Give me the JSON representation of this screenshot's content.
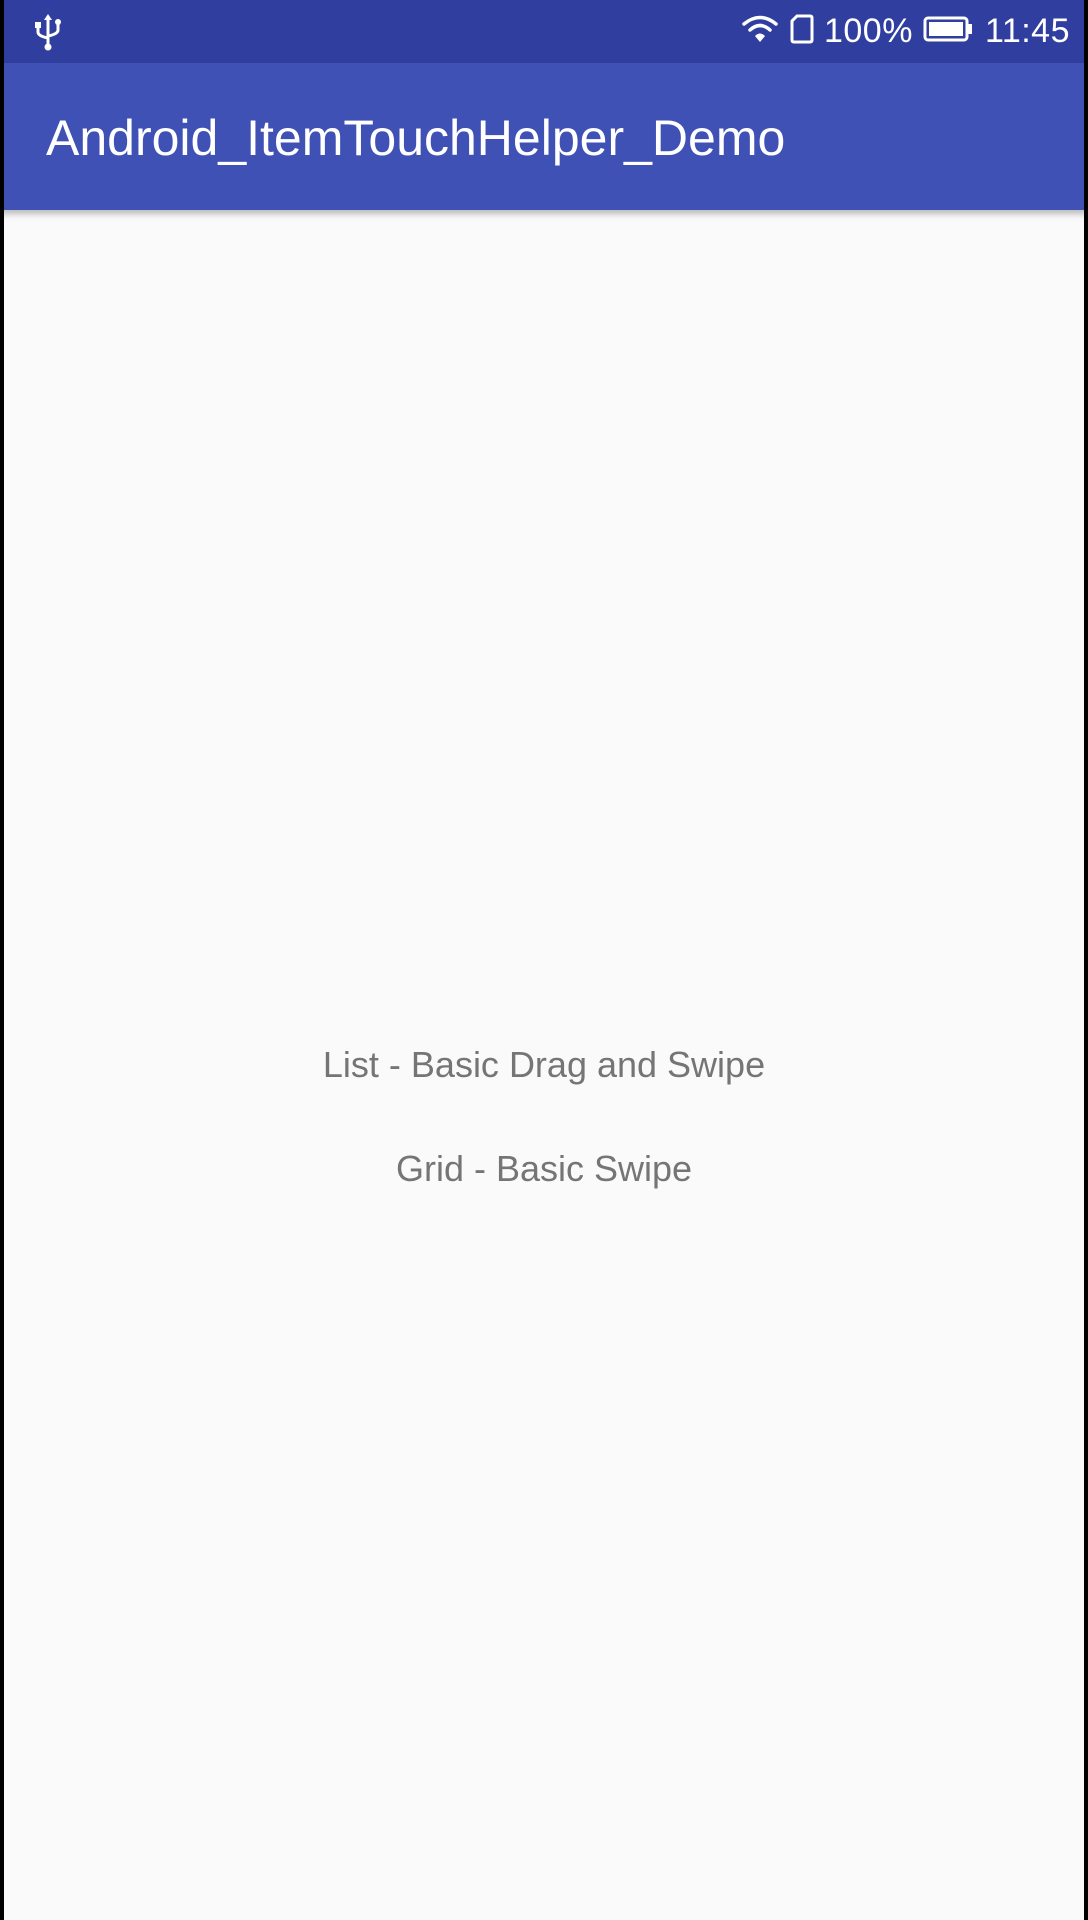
{
  "status_bar": {
    "left_icon": "usb-icon",
    "battery_percent": "100%",
    "time": "11:45",
    "icons": [
      "wifi-icon",
      "sim-icon",
      "battery-icon"
    ]
  },
  "app_bar": {
    "title": "Android_ItemTouchHelper_Demo"
  },
  "main": {
    "items": [
      {
        "label": "List - Basic Drag and Swipe"
      },
      {
        "label": "Grid - Basic Swipe"
      }
    ]
  },
  "colors": {
    "status_bar": "#303f9f",
    "app_bar": "#3f51b5",
    "background": "#fafafa",
    "item_text": "#757575"
  }
}
